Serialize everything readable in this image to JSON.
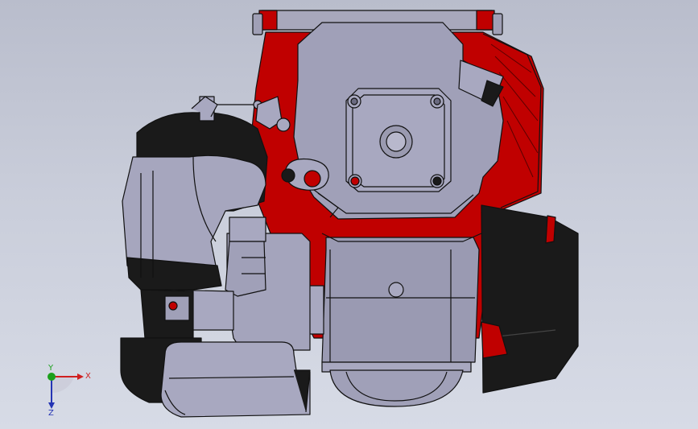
{
  "triad": {
    "x_label": "X",
    "y_label": "Y",
    "z_label": "Z",
    "x_color": "#d02020",
    "y_color": "#1ca01c",
    "z_color": "#2434b4"
  },
  "colors": {
    "background_top": "#b9bdcc",
    "background_bottom": "#d7dbe6",
    "body_gray": "#9a9ab0",
    "body_light": "#b0b0c6",
    "accent_red": "#c00000",
    "dark": "#1a1a1a",
    "edge": "#111111"
  }
}
